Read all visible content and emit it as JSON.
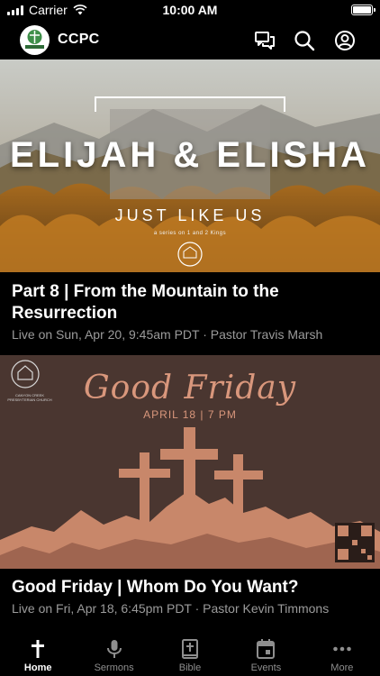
{
  "status_bar": {
    "carrier": "Carrier",
    "time": "10:00 AM",
    "battery_level": 1.0
  },
  "header": {
    "title": "CCPC",
    "logo_text": "CANYON CREEK",
    "icons": [
      "chat-icon",
      "search-icon",
      "account-icon"
    ]
  },
  "cards": [
    {
      "artwork": {
        "title": "ELIJAH & ELISHA",
        "subtitle": "JUST LIKE US",
        "note": "a series on 1 and 2 Kings"
      },
      "title": "Part 8 | From the Mountain to the Resurrection",
      "subtitle": "Live on Sun, Apr 20, 9:45am PDT · Pastor Travis Marsh"
    },
    {
      "artwork": {
        "title": "Good Friday",
        "date": "APRIL 18 | 7 PM",
        "church": "CANYON CREEK PRESBYTERIAN CHURCH"
      },
      "title": "Good Friday | Whom Do You Want?",
      "subtitle": "Live on Fri, Apr 18, 6:45pm PDT · Pastor Kevin Timmons"
    }
  ],
  "tabs": [
    {
      "label": "Home",
      "icon": "cross-icon",
      "active": true
    },
    {
      "label": "Sermons",
      "icon": "microphone-icon",
      "active": false
    },
    {
      "label": "Bible",
      "icon": "bible-icon",
      "active": false
    },
    {
      "label": "Events",
      "icon": "calendar-icon",
      "active": false
    },
    {
      "label": "More",
      "icon": "more-icon",
      "active": false
    }
  ],
  "colors": {
    "accent": "#ffffff",
    "inactive_tab": "#8e8e8e",
    "subtitle": "#9b9b9b",
    "good_friday_bg": "#4a3630",
    "good_friday_accent": "#d9977c"
  }
}
